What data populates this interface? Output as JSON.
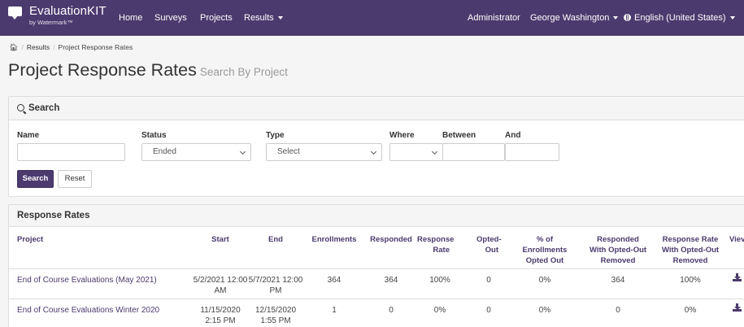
{
  "app": {
    "brand_name": "EvaluationKIT",
    "brand_sub": "by Watermark™"
  },
  "nav": {
    "home": "Home",
    "surveys": "Surveys",
    "projects": "Projects",
    "results": "Results",
    "role": "Administrator",
    "user": "George Washington",
    "language": "English (United States)"
  },
  "breadcrumb": {
    "results": "Results",
    "current": "Project Response Rates"
  },
  "page": {
    "title": "Project Response Rates",
    "subtitle": "Search By Project"
  },
  "search": {
    "heading": "Search",
    "name_label": "Name",
    "name_value": "",
    "status_label": "Status",
    "status_value": "Ended",
    "type_label": "Type",
    "type_value": "Select",
    "where_label": "Where",
    "where_value": "",
    "between_label": "Between",
    "between_value": "",
    "and_label": "And",
    "and_value": "",
    "search_button": "Search",
    "reset_button": "Reset"
  },
  "rates": {
    "heading": "Response Rates",
    "columns": {
      "project": "Project",
      "start": "Start",
      "end": "End",
      "enrollments": "Enrollments",
      "responded": "Responded",
      "response_rate": [
        "Response",
        "Rate"
      ],
      "opted_out": [
        "Opted-",
        "Out"
      ],
      "pct_opted_out": [
        "% of",
        "Enrollments",
        "Opted Out"
      ],
      "responded_removed": [
        "Responded",
        "With Opted-Out",
        "Removed"
      ],
      "rate_removed": [
        "Response Rate",
        "With Opted-Out",
        "Removed"
      ],
      "view": "Viev"
    },
    "rows": [
      {
        "project": "End of Course Evaluations (May 2021)",
        "start": [
          "5/2/2021 12:00",
          "AM"
        ],
        "end": [
          "5/7/2021 12:00",
          "PM"
        ],
        "enrollments": "364",
        "responded": "364",
        "response_rate": "100%",
        "opted_out": "0",
        "pct_opted_out": "0%",
        "responded_removed": "364",
        "rate_removed": "100%"
      },
      {
        "project": "End of Course Evaluations Winter 2020",
        "start": [
          "11/15/2020",
          "2:15 PM"
        ],
        "end": [
          "12/15/2020",
          "1:55 PM"
        ],
        "enrollments": "1",
        "responded": "0",
        "response_rate": "0%",
        "opted_out": "0",
        "pct_opted_out": "0%",
        "responded_removed": "0",
        "rate_removed": "0%"
      }
    ]
  },
  "icons": {
    "brand": "chat-bubble-icon",
    "home": "home-icon",
    "globe": "globe-icon",
    "search": "search-icon",
    "download": "download-icon"
  },
  "colors": {
    "navbar": "#4b3a6e",
    "accent": "#4b3a6e",
    "panel_head": "#f5f5f5"
  }
}
